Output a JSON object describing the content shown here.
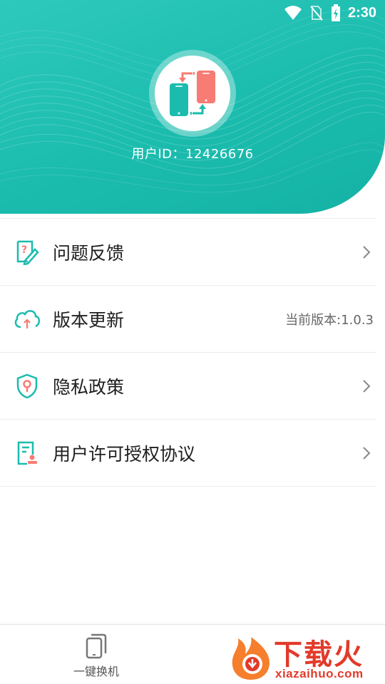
{
  "status_bar": {
    "time": "2:30",
    "icons": [
      "wifi-icon",
      "no-sim-icon",
      "battery-charging-icon"
    ]
  },
  "header": {
    "user_id_text": "用户ID：12426676",
    "avatar_icon": "phone-transfer-icon",
    "colors": {
      "primary": "#1bbcae",
      "accent_red": "#f67c74"
    }
  },
  "menu": {
    "items": [
      {
        "label": "问题反馈",
        "icon": "feedback-icon",
        "right": "chevron"
      },
      {
        "label": "版本更新",
        "icon": "cloud-update-icon",
        "right_text": "当前版本:1.0.3"
      },
      {
        "label": "隐私政策",
        "icon": "privacy-shield-icon",
        "right": "chevron"
      },
      {
        "label": "用户许可授权协议",
        "icon": "agreement-document-icon",
        "right": "chevron"
      }
    ]
  },
  "bottom_nav": {
    "tabs": [
      {
        "label": "一键换机",
        "icon": "phone-switch-icon"
      }
    ]
  },
  "watermark": {
    "text": "下载火",
    "sub": "xiazaihuo.com"
  }
}
